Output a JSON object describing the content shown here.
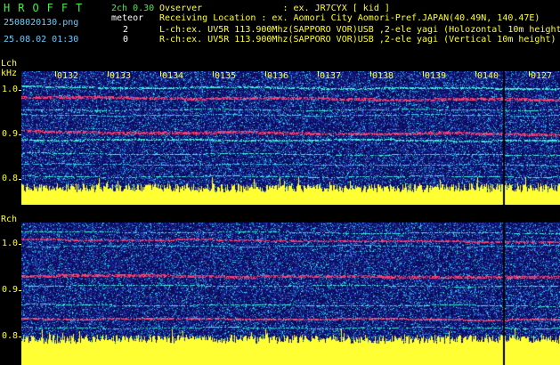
{
  "header": {
    "title": "HROFFT",
    "channel": "2ch 0.30",
    "meteor_label": "meteor",
    "filename": "2508020130.png",
    "datetime": "25.08.02 01:30",
    "count_l": "2",
    "count_r": "0",
    "observer": "Ovserver               : ex. JR7CYX [ kid ]",
    "location": "Receiving Location : ex. Aomori City Aomori-Pref.JAPAN(40.49N, 140.47E)",
    "lch_info": "L-ch:ex. UV5R 113.900Mhz(SAPPORO VOR)USB ,2-ele yagi (Holozontal 10m height)",
    "rch_info": "R-ch:ex. UV5R 113.900Mhz(SAPPORO VOR)USB ,2-ele yagi (Vertical 10m height)"
  },
  "lch": {
    "label": "Lch",
    "unit": "kHz",
    "y_labels": [
      "1.0",
      "0.9",
      "0.8"
    ],
    "markers": [
      "0132",
      "0133",
      "0134",
      "0135",
      "0136",
      "0137",
      "0138",
      "0139",
      "0140",
      "0127"
    ]
  },
  "rch": {
    "label": "Rch",
    "y_labels": [
      "1.0",
      "0.9",
      "0.8"
    ]
  },
  "colors": {
    "background": "#000000",
    "spectrogram_base": "#10106e",
    "noise_floor": "#ffff33",
    "carrier_red": "#ff3a6a",
    "carrier_cyan": "#3cf0e0",
    "text_cyan": "#66ccff",
    "text_green": "#44ee44"
  }
}
